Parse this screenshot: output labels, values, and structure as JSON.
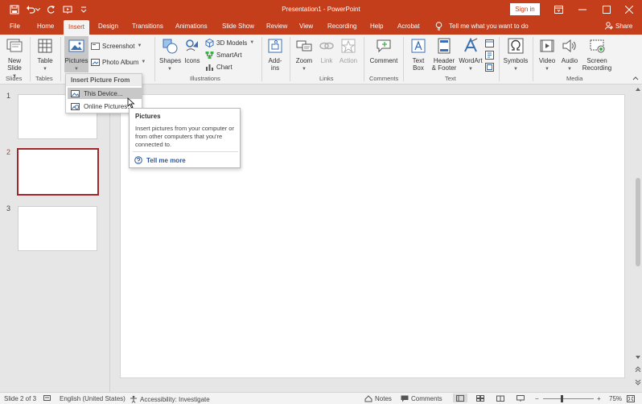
{
  "title_bar": {
    "document_title": "Presentation1 - PowerPoint",
    "sign_in_label": "Sign in",
    "icons": [
      "save-icon",
      "undo-icon",
      "redo-icon",
      "start-from-beginning-icon",
      "customize-quick-access-icon",
      "ribbon-display-icon",
      "minimize-icon",
      "maximize-icon",
      "close-icon"
    ]
  },
  "tabs": [
    "File",
    "Home",
    "Insert",
    "Design",
    "Transitions",
    "Animations",
    "Slide Show",
    "Review",
    "View",
    "Recording",
    "Help",
    "Acrobat"
  ],
  "active_tab": "Insert",
  "tell_me": "Tell me what you want to do",
  "share_label": "Share",
  "ribbon": {
    "new_slide": [
      "New",
      "Slide"
    ],
    "table": "Table",
    "pictures": "Pictures",
    "screenshot": "Screenshot",
    "photo_album": "Photo Album",
    "shapes": "Shapes",
    "icons": "Icons",
    "models_3d": "3D Models",
    "smartart": "SmartArt",
    "chart": "Chart",
    "addins": [
      "Add-",
      "ins"
    ],
    "zoom": "Zoom",
    "link": "Link",
    "action": "Action",
    "comment": "Comment",
    "text_box": [
      "Text",
      "Box"
    ],
    "header_footer": [
      "Header",
      "& Footer"
    ],
    "wordart": "WordArt",
    "symbols": "Symbols",
    "video": "Video",
    "audio": "Audio",
    "screen_recording": [
      "Screen",
      "Recording"
    ],
    "groups": {
      "slides": "Slides",
      "tables": "Tables",
      "illustrations": "Illustrations",
      "links": "Links",
      "comments": "Comments",
      "text": "Text",
      "media": "Media"
    }
  },
  "dropdown": {
    "header": "Insert Picture From",
    "items": [
      {
        "label": "This Device...",
        "icon": "image-icon"
      },
      {
        "label": "Online Pictures...",
        "icon": "online-picture-icon"
      }
    ]
  },
  "tooltip": {
    "title": "Pictures",
    "body": "Insert pictures from your computer or from other computers that you're connected to.",
    "link": "Tell me more"
  },
  "slides": [
    {
      "number": "1",
      "selected": false
    },
    {
      "number": "2",
      "selected": true
    },
    {
      "number": "3",
      "selected": false
    }
  ],
  "status_bar": {
    "slide_info": "Slide 2 of 3",
    "language": "English (United States)",
    "accessibility": "Accessibility: Investigate",
    "notes": "Notes",
    "comments": "Comments",
    "zoom_minus": "−",
    "zoom_plus": "+",
    "zoom_level": "75%"
  },
  "colors": {
    "accent": "#c43e1c",
    "selected_slide_border": "#a3262a",
    "link": "#2b579a"
  }
}
